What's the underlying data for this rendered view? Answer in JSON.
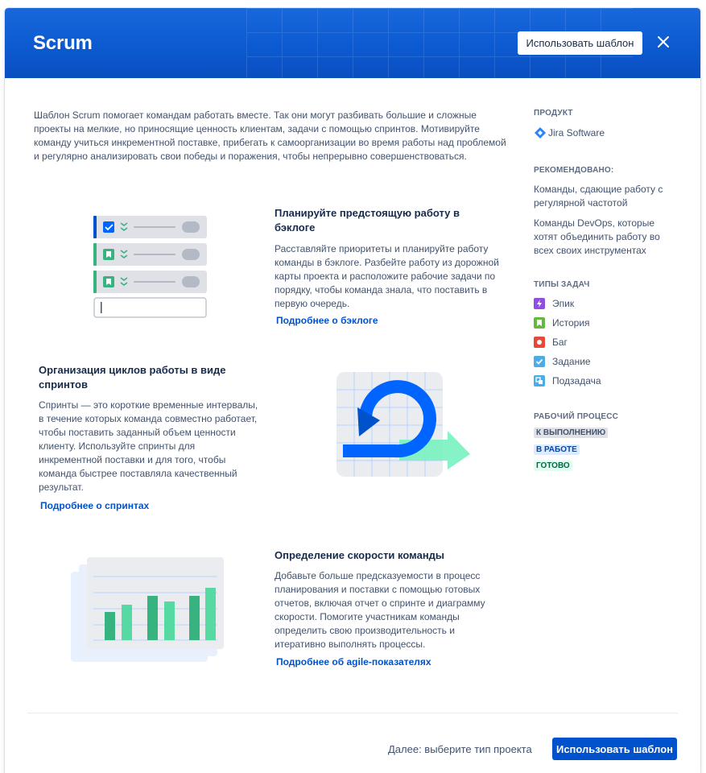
{
  "header": {
    "title": "Scrum",
    "use_template_label": "Использовать шаблон"
  },
  "intro": "Шаблон Scrum помогает командам работать вместе. Так они могут разбивать большие и сложные проекты на мелкие, но приносящие ценность клиентам, задачи с помощью спринтов. Мотивируйте команду учиться инкрементной поставке, прибегать к самоорганизации во время работы над проблемой и регулярно анализировать свои победы и поражения, чтобы непрерывно совершенствоваться.",
  "features": [
    {
      "title": "Планируйте предстоящую работу в бэклоге",
      "text": "Расставляйте приоритеты и планируйте работу команды в бэклоге. Разбейте работу из дорожной карты проекта и расположите рабочие задачи по порядку, чтобы команда знала, что поставить в первую очередь.",
      "link": "Подробнее о бэклоге"
    },
    {
      "title": "Организация циклов работы в виде спринтов",
      "text": "Спринты — это короткие временные интервалы, в течение которых команда совместно работает, чтобы поставить заданный объем ценности клиенту. Используйте спринты для инкрементной поставки и для того, чтобы команда быстрее поставляла качественный результат.",
      "link": "Подробнее о спринтах"
    },
    {
      "title": "Определение скорости команды",
      "text": "Добавьте больше предсказуемости в процесс планирования и поставки с помощью готовых отчетов, включая отчет о спринте и диаграмму скорости. Помогите участникам команды определить свою производительность и итеративно выполнять процессы.",
      "link": "Подробнее об agile-показателях"
    }
  ],
  "sidebar": {
    "product_heading": "ПРОДУКТ",
    "product_name": "Jira Software",
    "recommended_heading": "РЕКОМЕНДОВАНО:",
    "recommended": [
      "Команды, сдающие работу с регулярной частотой",
      "Команды DevOps, которые хотят объединить работу во всех своих инструментах"
    ],
    "issue_types_heading": "ТИПЫ ЗАДАЧ",
    "issue_types": [
      {
        "label": "Эпик",
        "icon": "epic-icon",
        "color": "#904ee2"
      },
      {
        "label": "История",
        "icon": "story-icon",
        "color": "#63ba3c"
      },
      {
        "label": "Баг",
        "icon": "bug-icon",
        "color": "#e5493a"
      },
      {
        "label": "Задание",
        "icon": "task-icon",
        "color": "#4bade8"
      },
      {
        "label": "Подзадача",
        "icon": "subtask-icon",
        "color": "#4bade8"
      }
    ],
    "workflow_heading": "РАБОЧИЙ ПРОЦЕСС",
    "workflow": [
      {
        "label": "К ВЫПОЛНЕНИЮ",
        "color": "#42526e",
        "bg": "#dfe1e6"
      },
      {
        "label": "В РАБОТЕ",
        "color": "#0747a6",
        "bg": "#deebff"
      },
      {
        "label": "ГОТОВО",
        "color": "#006644",
        "bg": "#e3fcef"
      }
    ]
  },
  "footer": {
    "next_text": "Далее: выберите тип проекта",
    "use_template_label": "Использовать шаблон"
  },
  "colors": {
    "header_blue": "#0c5ad1",
    "primary": "#0052cc",
    "green_bar": "#36b37e"
  }
}
